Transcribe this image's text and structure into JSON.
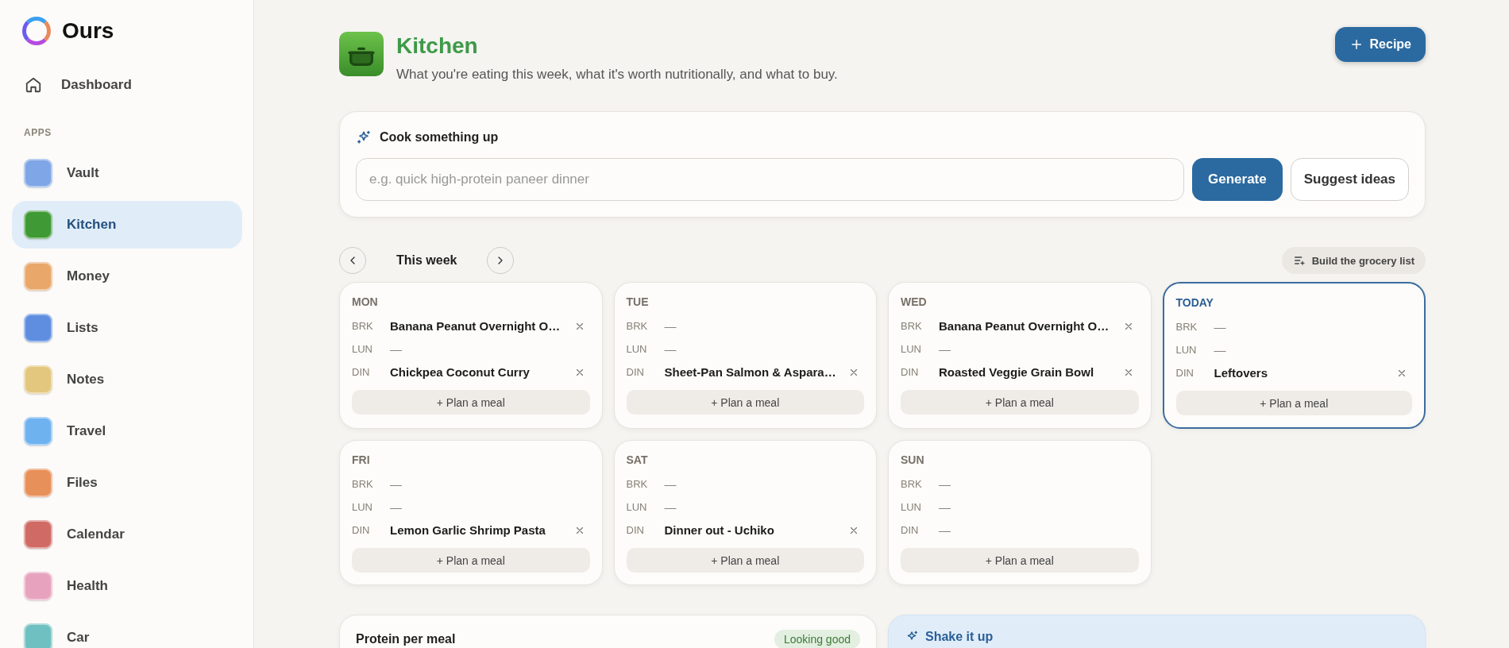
{
  "brand": {
    "name": "Ours"
  },
  "sidebar": {
    "dashboard": "Dashboard",
    "section_label": "APPS",
    "items": [
      {
        "label": "Vault",
        "selected": false,
        "color": "#7fa6e6"
      },
      {
        "label": "Kitchen",
        "selected": true,
        "color": "#3f9a35"
      },
      {
        "label": "Money",
        "selected": false,
        "color": "#e9a76a"
      },
      {
        "label": "Lists",
        "selected": false,
        "color": "#5f8ee0"
      },
      {
        "label": "Notes",
        "selected": false,
        "color": "#e3c77e"
      },
      {
        "label": "Travel",
        "selected": false,
        "color": "#6fb2f0"
      },
      {
        "label": "Files",
        "selected": false,
        "color": "#e8905a"
      },
      {
        "label": "Calendar",
        "selected": false,
        "color": "#d06a64"
      },
      {
        "label": "Health",
        "selected": false,
        "color": "#e7a3bd"
      },
      {
        "label": "Car",
        "selected": false,
        "color": "#6fc0c0"
      }
    ]
  },
  "header": {
    "title": "Kitchen",
    "subtitle": "What you're eating this week, what it's worth nutritionally, and what to buy.",
    "button": "Recipe"
  },
  "cook": {
    "title": "Cook something up",
    "placeholder": "e.g. quick high-protein paneer dinner",
    "buttons": [
      "Generate",
      "Suggest ideas"
    ]
  },
  "week": {
    "label": "This week",
    "grocery_button": "Build the grocery list"
  },
  "days": [
    {
      "label": "MON",
      "today": false,
      "meals": [
        {
          "slot": "BRK",
          "name": "Banana Peanut Overnight O…",
          "removable": true
        },
        {
          "slot": "LUN",
          "name": "—",
          "removable": false
        },
        {
          "slot": "DIN",
          "name": "Chickpea Coconut Curry",
          "removable": true
        }
      ],
      "add": "+ Plan a meal"
    },
    {
      "label": "TUE",
      "today": false,
      "meals": [
        {
          "slot": "BRK",
          "name": "—",
          "removable": false
        },
        {
          "slot": "LUN",
          "name": "—",
          "removable": false
        },
        {
          "slot": "DIN",
          "name": "Sheet-Pan Salmon & Aspara…",
          "removable": true
        }
      ],
      "add": "+ Plan a meal"
    },
    {
      "label": "WED",
      "today": false,
      "meals": [
        {
          "slot": "BRK",
          "name": "Banana Peanut Overnight O…",
          "removable": true
        },
        {
          "slot": "LUN",
          "name": "—",
          "removable": false
        },
        {
          "slot": "DIN",
          "name": "Roasted Veggie Grain Bowl",
          "removable": true
        }
      ],
      "add": "+ Plan a meal"
    },
    {
      "label": "TODAY",
      "today": true,
      "meals": [
        {
          "slot": "BRK",
          "name": "—",
          "removable": false
        },
        {
          "slot": "LUN",
          "name": "—",
          "removable": false
        },
        {
          "slot": "DIN",
          "name": "Leftovers",
          "removable": true
        }
      ],
      "add": "+ Plan a meal"
    },
    {
      "label": "FRI",
      "today": false,
      "meals": [
        {
          "slot": "BRK",
          "name": "—",
          "removable": false
        },
        {
          "slot": "LUN",
          "name": "—",
          "removable": false
        },
        {
          "slot": "DIN",
          "name": "Lemon Garlic Shrimp Pasta",
          "removable": true
        }
      ],
      "add": "+ Plan a meal"
    },
    {
      "label": "SAT",
      "today": false,
      "meals": [
        {
          "slot": "BRK",
          "name": "—",
          "removable": false
        },
        {
          "slot": "LUN",
          "name": "—",
          "removable": false
        },
        {
          "slot": "DIN",
          "name": "Dinner out - Uchiko",
          "removable": true
        }
      ],
      "add": "+ Plan a meal"
    },
    {
      "label": "SUN",
      "today": false,
      "meals": [
        {
          "slot": "BRK",
          "name": "—",
          "removable": false
        },
        {
          "slot": "LUN",
          "name": "—",
          "removable": false
        },
        {
          "slot": "DIN",
          "name": "—",
          "removable": false
        }
      ],
      "add": "+ Plan a meal"
    }
  ],
  "protein_card": {
    "title": "Protein per meal",
    "badge": "Looking good"
  },
  "shake_card": {
    "title": "Shake it up"
  }
}
